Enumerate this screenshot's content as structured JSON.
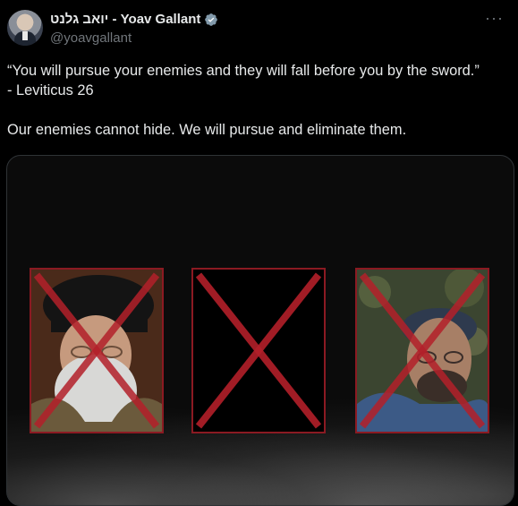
{
  "author": {
    "display_name": "יואב גלנט - Yoav Gallant",
    "handle": "@yoavgallant",
    "verified": true
  },
  "actions": {
    "more_label": "···"
  },
  "tweet": {
    "line1": "“You will pursue your enemies and they will fall before you by the sword.”",
    "line2": "- Leviticus 26",
    "line3": "Our enemies cannot hide. We will pursue and eliminate them."
  },
  "media": {
    "cards": [
      {
        "content": "portrait",
        "crossed_out": true
      },
      {
        "content": "empty",
        "crossed_out": true
      },
      {
        "content": "portrait",
        "crossed_out": true
      }
    ],
    "x_color": "#b3202a",
    "frame_color": "#8b1a22"
  }
}
